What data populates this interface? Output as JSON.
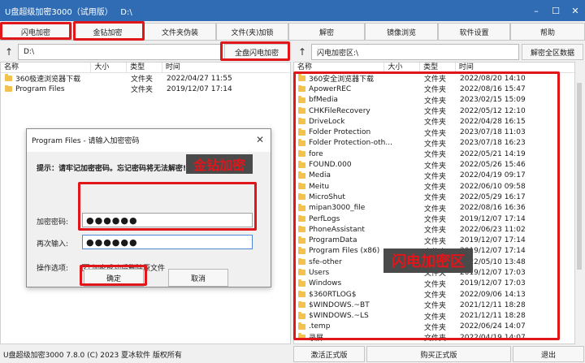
{
  "window": {
    "title": "U盘超级加密3000（试用版）   D:\\",
    "minimize": "–",
    "maximize": "☐",
    "close": "✕"
  },
  "toolbar": [
    {
      "label": "闪电加密"
    },
    {
      "label": "金钻加密"
    },
    {
      "label": "文件夹伪装"
    },
    {
      "label": "文件(夹)加锁"
    },
    {
      "label": "解密"
    },
    {
      "label": "镜像浏览"
    },
    {
      "label": "软件设置"
    },
    {
      "label": "帮助"
    }
  ],
  "left": {
    "path": "D:\\",
    "action": "全盘闪电加密",
    "columns": [
      "名称",
      "大小",
      "类型",
      "时间"
    ],
    "rows": [
      {
        "name": "360极速浏览器下载",
        "type": "文件夹",
        "time": "2022/04/27 11:55"
      },
      {
        "name": "Program Files",
        "type": "文件夹",
        "time": "2019/12/07 17:14"
      }
    ]
  },
  "right": {
    "path": "闪电加密区:\\",
    "action": "解密全区数据",
    "columns": [
      "名称",
      "大小",
      "类型",
      "时间"
    ],
    "rows": [
      {
        "name": "360安全浏览器下载",
        "type": "文件夹",
        "time": "2022/08/20 14:10"
      },
      {
        "name": "ApowerREC",
        "type": "文件夹",
        "time": "2022/08/16 15:47"
      },
      {
        "name": "bfMedia",
        "type": "文件夹",
        "time": "2023/02/15 15:09"
      },
      {
        "name": "CHKFileRecovery",
        "type": "文件夹",
        "time": "2022/05/12 12:10"
      },
      {
        "name": "DriveLock",
        "type": "文件夹",
        "time": "2022/04/28 16:15"
      },
      {
        "name": "Folder Protection",
        "type": "文件夹",
        "time": "2023/07/18 11:03"
      },
      {
        "name": "Folder Protection-oth...",
        "type": "文件夹",
        "time": "2023/07/18 16:23"
      },
      {
        "name": "fore",
        "type": "文件夹",
        "time": "2022/05/21 14:19"
      },
      {
        "name": "FOUND.000",
        "type": "文件夹",
        "time": "2022/05/26 15:46"
      },
      {
        "name": "Media",
        "type": "文件夹",
        "time": "2022/04/19 09:17"
      },
      {
        "name": "Meitu",
        "type": "文件夹",
        "time": "2022/06/10 09:58"
      },
      {
        "name": "MicroShut",
        "type": "文件夹",
        "time": "2022/05/29 16:17"
      },
      {
        "name": "mipan3000_file",
        "type": "文件夹",
        "time": "2022/08/16 16:36"
      },
      {
        "name": "PerfLogs",
        "type": "文件夹",
        "time": "2019/12/07 17:14"
      },
      {
        "name": "PhoneAssistant",
        "type": "文件夹",
        "time": "2022/06/23 11:02"
      },
      {
        "name": "ProgramData",
        "type": "文件夹",
        "time": "2019/12/07 17:14"
      },
      {
        "name": "Program Files (x86)",
        "type": "文件夹",
        "time": "2019/12/07 17:14"
      },
      {
        "name": "sfe-other",
        "type": "文件夹",
        "time": "2022/05/10 13:48"
      },
      {
        "name": "Users",
        "type": "文件夹",
        "time": "2019/12/07 17:03"
      },
      {
        "name": "Windows",
        "type": "文件夹",
        "time": "2019/12/07 17:03"
      },
      {
        "name": "$360RTLOG$",
        "type": "文件夹",
        "time": "2022/09/06 14:13"
      },
      {
        "name": "$WINDOWS.~BT",
        "type": "文件夹",
        "time": "2021/12/11 18:28"
      },
      {
        "name": "$WINDOWS.~LS",
        "type": "文件夹",
        "time": "2021/12/11 18:28"
      },
      {
        "name": ".temp",
        "type": "文件夹",
        "time": "2022/06/24 14:07"
      },
      {
        "name": "录屏",
        "type": "文件夹",
        "time": "2022/04/19 14:07"
      }
    ]
  },
  "dialog": {
    "title": "Program Files - 请输入加密密码",
    "hint": "提示：请牢记加密密码。忘记密码将无法解密!!!",
    "password_label": "加密密码:",
    "password_value": "●●●●●●",
    "confirm_label": "再次输入:",
    "confirm_value": "●●●●●●",
    "options_label": "操作选项:",
    "option_delete": "加密成功后删除原文件",
    "check_mark": "✓",
    "ok": "确定",
    "cancel": "取消"
  },
  "callouts": {
    "gold": "金钻加密",
    "flash": "闪电加密区"
  },
  "status": {
    "text": "U盘超级加密3000 7.8.0 (C) 2023 夏冰软件 版权所有",
    "activate": "激活正式版",
    "buy": "购买正式版",
    "exit": "退出"
  },
  "icons": {
    "up": "↑",
    "close": "✕"
  },
  "colors": {
    "titlebar": "#2f6cb3",
    "highlight": "#e0161b",
    "folder": "#f2c14e"
  }
}
